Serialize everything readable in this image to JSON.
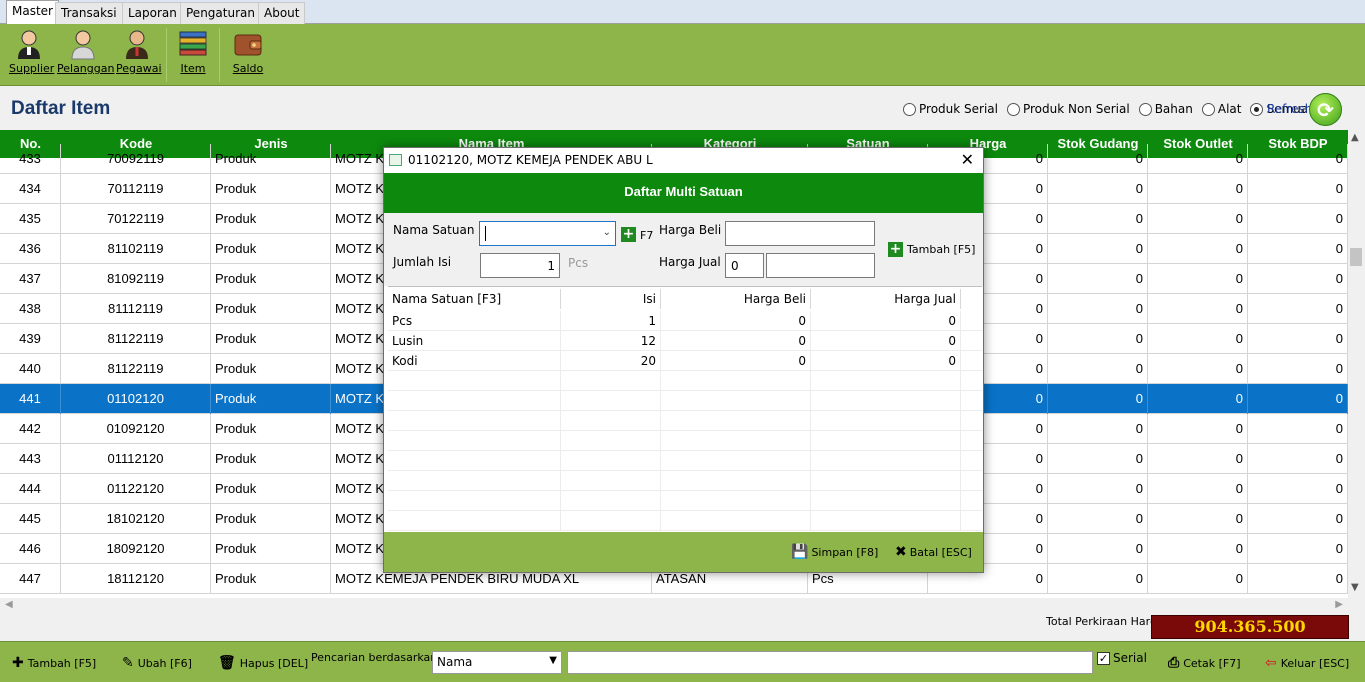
{
  "menu": {
    "tabs": [
      "Master",
      "Transaksi",
      "Laporan",
      "Pengaturan",
      "About"
    ]
  },
  "toolbar": {
    "buttons": [
      {
        "label": "Supplier",
        "icon": "supplier-person-icon"
      },
      {
        "label": "Pelanggan",
        "icon": "customer-person-icon"
      },
      {
        "label": "Pegawai",
        "icon": "employee-person-icon"
      },
      {
        "label": "Item",
        "icon": "item-stack-icon"
      },
      {
        "label": "Saldo",
        "icon": "wallet-icon"
      }
    ]
  },
  "page": {
    "title": "Daftar Item"
  },
  "filters": {
    "options": [
      "Produk Serial",
      "Produk Non Serial",
      "Bahan",
      "Alat",
      "Semua"
    ],
    "selected": "Semua",
    "refresh_label": "Refresh"
  },
  "grid": {
    "columns": [
      "No.",
      "Kode",
      "Jenis",
      "Nama Item",
      "Kategori",
      "Satuan",
      "Harga",
      "Stok Gudang",
      "Stok Outlet",
      "Stok BDP"
    ],
    "rows": [
      {
        "no": "433",
        "kode": "70092119",
        "jenis": "Produk",
        "nama": "MOTZ K",
        "kategori": "",
        "satuan": "",
        "harga": "0",
        "stok_gudang": "0",
        "stok_outlet": "0",
        "stok_bdp": "0"
      },
      {
        "no": "434",
        "kode": "70112119",
        "jenis": "Produk",
        "nama": "MOTZ K",
        "kategori": "",
        "satuan": "",
        "harga": "0",
        "stok_gudang": "0",
        "stok_outlet": "0",
        "stok_bdp": "0"
      },
      {
        "no": "435",
        "kode": "70122119",
        "jenis": "Produk",
        "nama": "MOTZ K",
        "kategori": "",
        "satuan": "",
        "harga": "0",
        "stok_gudang": "0",
        "stok_outlet": "0",
        "stok_bdp": "0"
      },
      {
        "no": "436",
        "kode": "81102119",
        "jenis": "Produk",
        "nama": "MOTZ K",
        "kategori": "",
        "satuan": "",
        "harga": "0",
        "stok_gudang": "0",
        "stok_outlet": "0",
        "stok_bdp": "0"
      },
      {
        "no": "437",
        "kode": "81092119",
        "jenis": "Produk",
        "nama": "MOTZ K",
        "kategori": "",
        "satuan": "",
        "harga": "0",
        "stok_gudang": "0",
        "stok_outlet": "0",
        "stok_bdp": "0"
      },
      {
        "no": "438",
        "kode": "81112119",
        "jenis": "Produk",
        "nama": "MOTZ K",
        "kategori": "",
        "satuan": "",
        "harga": "0",
        "stok_gudang": "0",
        "stok_outlet": "0",
        "stok_bdp": "0"
      },
      {
        "no": "439",
        "kode": "81122119",
        "jenis": "Produk",
        "nama": "MOTZ K",
        "kategori": "",
        "satuan": "",
        "harga": "0",
        "stok_gudang": "0",
        "stok_outlet": "0",
        "stok_bdp": "0"
      },
      {
        "no": "440",
        "kode": "81122119",
        "jenis": "Produk",
        "nama": "MOTZ K",
        "kategori": "",
        "satuan": "",
        "harga": "0",
        "stok_gudang": "0",
        "stok_outlet": "0",
        "stok_bdp": "0"
      },
      {
        "no": "441",
        "kode": "01102120",
        "jenis": "Produk",
        "nama": "MOTZ K",
        "kategori": "",
        "satuan": "",
        "harga": "0",
        "stok_gudang": "0",
        "stok_outlet": "0",
        "stok_bdp": "0",
        "selected": true
      },
      {
        "no": "442",
        "kode": "01092120",
        "jenis": "Produk",
        "nama": "MOTZ K",
        "kategori": "",
        "satuan": "",
        "harga": "0",
        "stok_gudang": "0",
        "stok_outlet": "0",
        "stok_bdp": "0"
      },
      {
        "no": "443",
        "kode": "01112120",
        "jenis": "Produk",
        "nama": "MOTZ K",
        "kategori": "",
        "satuan": "",
        "harga": "0",
        "stok_gudang": "0",
        "stok_outlet": "0",
        "stok_bdp": "0"
      },
      {
        "no": "444",
        "kode": "01122120",
        "jenis": "Produk",
        "nama": "MOTZ K",
        "kategori": "",
        "satuan": "",
        "harga": "0",
        "stok_gudang": "0",
        "stok_outlet": "0",
        "stok_bdp": "0"
      },
      {
        "no": "445",
        "kode": "18102120",
        "jenis": "Produk",
        "nama": "MOTZ K",
        "kategori": "",
        "satuan": "",
        "harga": "0",
        "stok_gudang": "0",
        "stok_outlet": "0",
        "stok_bdp": "0"
      },
      {
        "no": "446",
        "kode": "18092120",
        "jenis": "Produk",
        "nama": "MOTZ K",
        "kategori": "",
        "satuan": "",
        "harga": "0",
        "stok_gudang": "0",
        "stok_outlet": "0",
        "stok_bdp": "0"
      },
      {
        "no": "447",
        "kode": "18112120",
        "jenis": "Produk",
        "nama": "MOTZ KEMEJA PENDEK BIRU MUDA XL",
        "kategori": "ATASAN",
        "satuan": "Pcs",
        "harga": "0",
        "stok_gudang": "0",
        "stok_outlet": "0",
        "stok_bdp": "0"
      }
    ]
  },
  "total": {
    "label": "Total Perkiraan Harga",
    "value": "904.365.500"
  },
  "bottom": {
    "add_label": "Tambah [F5]",
    "edit_label": "Ubah [F6]",
    "delete_label": "Hapus [DEL]",
    "search_label": "Pencarian berdasarkan :",
    "search_field": "Nama",
    "search_value": "",
    "serial_label": "Serial",
    "serial_checked": true,
    "print_label": "Cetak [F7]",
    "exit_label": "Keluar [ESC]"
  },
  "modal": {
    "window_title": "01102120, MOTZ KEMEJA PENDEK ABU L",
    "header": "Daftar Multi Satuan",
    "form": {
      "nama_satuan_label": "Nama Satuan",
      "nama_satuan_value": "",
      "f7_label": "F7",
      "jumlah_isi_label": "Jumlah Isi",
      "jumlah_isi_value": "1",
      "unit_hint": "Pcs",
      "harga_beli_label": "Harga Beli",
      "harga_beli_value": "",
      "harga_jual_label": "Harga Jual",
      "harga_jual_value": "0",
      "harga_jual_extra": "",
      "tambah_label": "Tambah [F5]"
    },
    "table": {
      "columns": [
        "Nama Satuan [F3]",
        "Isi",
        "Harga Beli",
        "Harga Jual"
      ],
      "rows": [
        {
          "nama": "Pcs",
          "isi": "1",
          "harga_beli": "0",
          "harga_jual": "0"
        },
        {
          "nama": "Lusin",
          "isi": "12",
          "harga_beli": "0",
          "harga_jual": "0"
        },
        {
          "nama": "Kodi",
          "isi": "20",
          "harga_beli": "0",
          "harga_jual": "0"
        }
      ]
    },
    "footer": {
      "save_label": "Simpan [F8]",
      "cancel_label": "Batal [ESC]"
    }
  },
  "colors": {
    "green_bar": "#8db54a",
    "header_green": "#0d8a0d",
    "selection_blue": "#0a73c8",
    "total_bg": "#7a0a0a",
    "total_text": "#ffd700"
  }
}
